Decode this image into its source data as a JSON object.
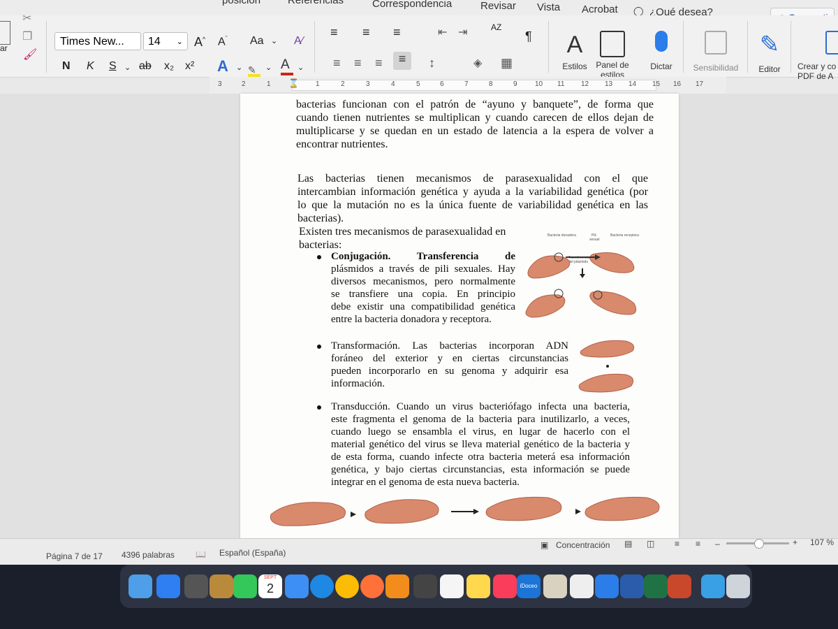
{
  "ribbon": {
    "tabs": [
      "posición",
      "Referencias",
      "Correspondencia",
      "Revisar",
      "Vista",
      "Acrobat"
    ],
    "search_placeholder": "¿Qué desea?",
    "share_label": "Compartir",
    "font_name": "Times New...",
    "font_size": "14",
    "clipboard_label": "ar",
    "format": {
      "bold": "N",
      "italic": "K",
      "underline": "S",
      "strike": "ab",
      "subscript": "x₂",
      "superscript": "x²",
      "grow": "A^",
      "shrink": "Aˇ",
      "case": "Aa"
    },
    "sort_label": "AZ",
    "pilcrow": "¶",
    "big_buttons": {
      "styles": "Estilos",
      "styles_pane_1": "Panel de",
      "styles_pane_2": "estilos",
      "dictate": "Dictar",
      "sensitivity": "Sensibilidad",
      "editor": "Editor",
      "create_pdf_1": "Crear y co",
      "create_pdf_2": "PDF de A"
    }
  },
  "ruler": {
    "numbers": [
      "3",
      "2",
      "1",
      "1",
      "2",
      "3",
      "4",
      "5",
      "6",
      "7",
      "8",
      "9",
      "10",
      "11",
      "12",
      "13",
      "14",
      "15",
      "16",
      "17"
    ]
  },
  "document": {
    "p1_lines": [
      "bacterias funcionan con el patrón de “ayuno y banquete”, de forma que",
      "cuando tienen nutrientes se multiplican y cuando carecen de ellos dejan de",
      "multiplicarse y se quedan en un estado de latencia a la espera de volver a",
      "encontrar nutrientes."
    ],
    "p2_lines": [
      "Las bacterias tienen mecanismos de parasexualidad con el que",
      "intercambian información genética y ayuda a la variabilidad genética (por",
      "lo que la mutación no es la única fuente de variabilidad genética en las",
      "bacterias)."
    ],
    "p3_lines": [
      "Existen tres mecanismos de parasexualidad en",
      "bacterias:"
    ],
    "bullets": [
      {
        "title": "Conjugación",
        "lines": [
          "Conjugación. Transferencia de",
          "plásmidos a través de pili sexuales. Hay",
          "diversos mecanismos, pero normalmente",
          "se transfiere una copia. En principio",
          "debe existir una compatibilidad genética",
          "entre la bacteria donadora y receptora."
        ]
      },
      {
        "title": "Transformación",
        "lines": [
          "Transformación. Las bacterias incorporan ADN",
          "foráneo del exterior y en ciertas circunstancias",
          "pueden incorporarlo en su genoma y adquirir esa",
          "información."
        ]
      },
      {
        "title": "Transducción",
        "lines": [
          "Transducción. Cuando un virus bacteriófago infecta una bacteria,",
          "este fragmenta el genoma de la bacteria para inutilizarlo, a veces,",
          "cuando luego se ensambla el virus, en lugar de hacerlo con el",
          "material genético del virus se lleva material genético de la bacteria y",
          "de esta forma, cuando infecte otra bacteria meterá esa información",
          "genética, y bajo ciertas circunstancias, esta información se puede",
          "integrar en el genoma de esta nueva bacteria."
        ]
      }
    ],
    "fig_conj_labels": {
      "donor": "Bacteria donadora",
      "pili_1": "Pili",
      "pili_2": "sexual",
      "recipient": "Bacteria receptora",
      "transfer_1": "Transferencia",
      "transfer_2": "del plásmido"
    }
  },
  "status": {
    "page": "Página 7 de 17",
    "words": "4396 palabras",
    "language": "Español (España)",
    "focus": "Concentración",
    "zoom": "107 %"
  },
  "dock": {
    "calendar_month": "SEPT",
    "calendar_day": "2",
    "idoceo_label": "iDoceo"
  }
}
